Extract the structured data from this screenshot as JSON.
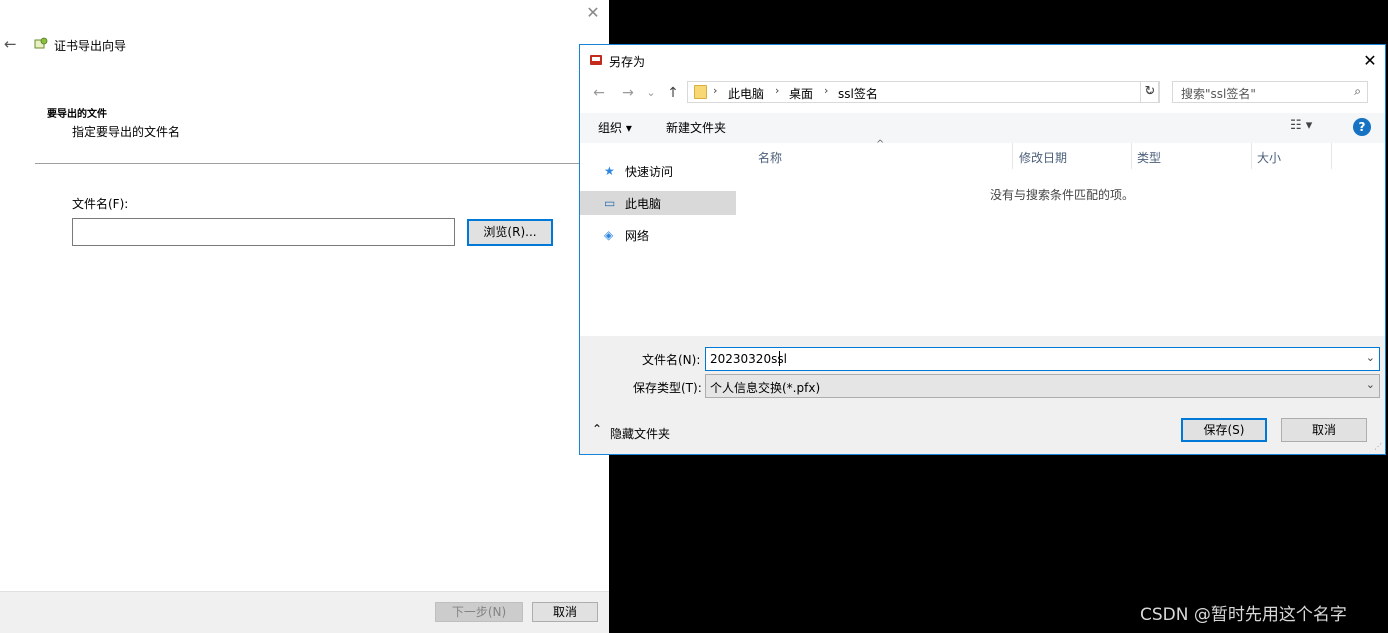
{
  "wizard": {
    "title": "证书导出向导",
    "close_glyph": "✕",
    "back_glyph": "←",
    "heading": "要导出的文件",
    "subheading": "指定要导出的文件名",
    "filename_label": "文件名(F):",
    "filename_value": "",
    "browse_label": "浏览(R)...",
    "next_label": "下一步(N)",
    "cancel_label": "取消"
  },
  "dialog": {
    "title": "另存为",
    "close_glyph": "✕",
    "nav": {
      "back": "←",
      "forward": "→",
      "recent": "⌄",
      "up": "↑"
    },
    "address": {
      "crumbs": [
        "此电脑",
        "桌面",
        "ssl签名"
      ],
      "separator": "›",
      "dropdown": "⌄",
      "refresh": "↻"
    },
    "search": {
      "placeholder": "搜索\"ssl签名\"",
      "icon": "⌕"
    },
    "toolbar": {
      "organize": "组织 ▾",
      "new_folder": "新建文件夹",
      "view": "☷ ▾",
      "help": "?"
    },
    "nav_pane": [
      {
        "label": "快速访问",
        "icon": "★",
        "selected": false
      },
      {
        "label": "此电脑",
        "icon": "▭",
        "selected": true
      },
      {
        "label": "网络",
        "icon": "◈",
        "selected": false
      }
    ],
    "columns": [
      "名称",
      "修改日期",
      "类型",
      "大小"
    ],
    "sort_caret": "^",
    "empty_message": "没有与搜索条件匹配的项。",
    "filename_label": "文件名(N):",
    "filename_value": "20230320ssl",
    "filetype_label": "保存类型(T):",
    "filetype_value": "个人信息交换(*.pfx)",
    "combo_dropdown": "⌄",
    "hide_folders": "隐藏文件夹",
    "hide_chevron": "⌃",
    "save_label": "保存(S)",
    "cancel_label": "取消",
    "grip": "⋰"
  },
  "watermark": "CSDN @暂时先用这个名字",
  "colors": {
    "accent": "#0078d7",
    "background": "#000000",
    "help": "#1672c2"
  }
}
